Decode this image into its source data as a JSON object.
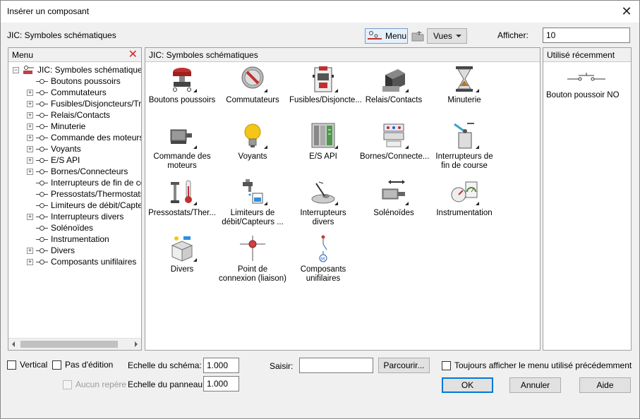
{
  "window": {
    "title": "Insérer un composant"
  },
  "toolbar": {
    "library_label": "JIC: Symboles schématiques",
    "menu_button": "Menu",
    "views_button": "Vues",
    "show_label": "Afficher:",
    "show_value": "10"
  },
  "menu_panel": {
    "header": "Menu",
    "root": "JIC: Symboles schématiques",
    "items": [
      {
        "label": "Boutons poussoirs",
        "expandable": false
      },
      {
        "label": "Commutateurs",
        "expandable": true
      },
      {
        "label": "Fusibles/Disjoncteurs/Tran",
        "expandable": true
      },
      {
        "label": "Relais/Contacts",
        "expandable": true
      },
      {
        "label": "Minuterie",
        "expandable": true
      },
      {
        "label": "Commande des moteurs",
        "expandable": true
      },
      {
        "label": "Voyants",
        "expandable": true
      },
      {
        "label": "E/S API",
        "expandable": true
      },
      {
        "label": "Bornes/Connecteurs",
        "expandable": true
      },
      {
        "label": "Interrupteurs de fin de cour",
        "expandable": false
      },
      {
        "label": "Pressostats/Thermostats",
        "expandable": false
      },
      {
        "label": "Limiteurs de débit/Capteurs",
        "expandable": false
      },
      {
        "label": "Interrupteurs divers",
        "expandable": true
      },
      {
        "label": "Solénoïdes",
        "expandable": false
      },
      {
        "label": "Instrumentation",
        "expandable": false
      },
      {
        "label": "Divers",
        "expandable": true
      },
      {
        "label": "Composants unifilaires",
        "expandable": true
      }
    ]
  },
  "main_panel": {
    "header": "JIC: Symboles schématiques",
    "items": [
      {
        "label": "Boutons poussoirs",
        "icon": "push-button-icon"
      },
      {
        "label": "Commutateurs",
        "icon": "selector-switch-icon"
      },
      {
        "label": "Fusibles/Disjoncte...",
        "icon": "fuse-breaker-icon"
      },
      {
        "label": "Relais/Contacts",
        "icon": "relay-icon"
      },
      {
        "label": "Minuterie",
        "icon": "hourglass-icon"
      },
      {
        "label": "Commande des moteurs",
        "icon": "motor-icon"
      },
      {
        "label": "Voyants",
        "icon": "light-bulb-icon"
      },
      {
        "label": "E/S API",
        "icon": "plc-io-icon"
      },
      {
        "label": "Bornes/Connecte...",
        "icon": "terminal-icon"
      },
      {
        "label": "Interrupteurs de fin de course",
        "icon": "limit-switch-icon"
      },
      {
        "label": "Pressostats/Ther...",
        "icon": "pressure-thermo-icon"
      },
      {
        "label": "Limiteurs de débit/Capteurs ...",
        "icon": "flow-sensor-icon"
      },
      {
        "label": "Interrupteurs divers",
        "icon": "misc-switch-icon"
      },
      {
        "label": "Solénoïdes",
        "icon": "solenoid-icon"
      },
      {
        "label": "Instrumentation",
        "icon": "gauge-icon"
      },
      {
        "label": "Divers",
        "icon": "box-icon"
      },
      {
        "label": "Point de connexion (liaison)",
        "icon": "connection-point-icon"
      },
      {
        "label": "Composants unifilaires",
        "icon": "single-line-icon"
      }
    ]
  },
  "recent_panel": {
    "header": "Utilisé récemment",
    "items": [
      {
        "label": "Bouton poussoir NO",
        "icon": "push-button-no-icon"
      }
    ]
  },
  "bottom": {
    "vertical_label": "Vertical",
    "no_edit_label": "Pas d'édition",
    "no_marker_label": "Aucun repère",
    "schema_scale_label": "Echelle du schéma:",
    "schema_scale_value": "1.000",
    "panel_scale_label": "Echelle du panneau:",
    "panel_scale_value": "1.000",
    "type_label": "Saisir:",
    "type_value": "",
    "browse_button": "Parcourir...",
    "always_show_label": "Toujours afficher le menu utilisé précédemment",
    "ok_button": "OK",
    "cancel_button": "Annuler",
    "help_button": "Aide"
  }
}
